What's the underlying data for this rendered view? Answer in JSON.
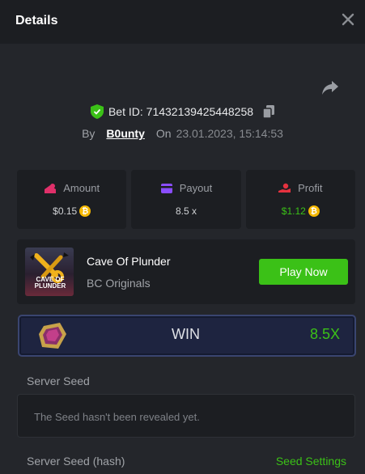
{
  "header": {
    "title": "Details"
  },
  "bet": {
    "id_text": "Bet ID: 71432139425448258",
    "by_label": "By",
    "user": "B0unty",
    "on_label": "On",
    "date": "23.01.2023, 15:14:53"
  },
  "stats": {
    "amount": {
      "label": "Amount",
      "value": "$0.15"
    },
    "payout": {
      "label": "Payout",
      "value": "8.5 x"
    },
    "profit": {
      "label": "Profit",
      "value": "$1.12"
    }
  },
  "game": {
    "name": "Cave Of Plunder",
    "provider": "BC Originals",
    "thumb_text": "CAVE OF PLUNDER",
    "play_label": "Play Now"
  },
  "result": {
    "label": "WIN",
    "multiplier": "8.5X"
  },
  "server_seed": {
    "label": "Server Seed",
    "placeholder": "The Seed hasn't been revealed yet."
  },
  "server_seed_hash": {
    "label": "Server Seed (hash)",
    "settings_label": "Seed Settings"
  },
  "colors": {
    "accent": "#3bc117",
    "coin": "#f5b800",
    "amount_icon": "#e0306a",
    "payout_icon": "#8a4dff",
    "profit_icon": "#e5323f"
  },
  "icons": [
    "close-icon",
    "share-icon",
    "shield-check-icon",
    "copy-icon",
    "amount-icon",
    "payout-icon",
    "profit-icon",
    "coin-icon",
    "gem-icon"
  ]
}
